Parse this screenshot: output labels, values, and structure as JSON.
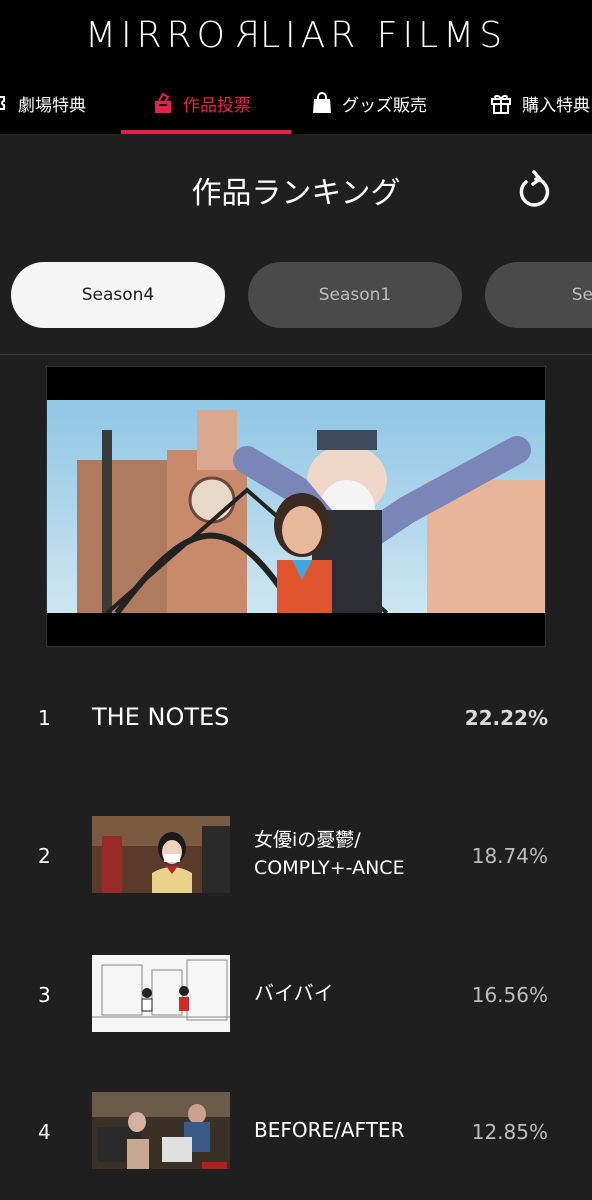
{
  "app": {
    "logo_prefix": "MIRRO",
    "logo_mirror": "R",
    "logo_suffix": "LIAR FILMS"
  },
  "nav": {
    "items": [
      {
        "label": "劇場特典",
        "icon": "ticket-icon"
      },
      {
        "label": "作品投票",
        "icon": "ballot-box-icon",
        "active": true
      },
      {
        "label": "グッズ販売",
        "icon": "shopping-bag-icon"
      },
      {
        "label": "購入特典",
        "icon": "gift-icon"
      }
    ]
  },
  "ranking": {
    "title": "作品ランキング",
    "refresh_icon": "refresh-icon"
  },
  "seasons": [
    "Season4",
    "Season1",
    "Seas"
  ],
  "active_season": "Season4",
  "rows": [
    {
      "rank": "1",
      "title": "THE NOTES",
      "percent": "22.22%"
    },
    {
      "rank": "2",
      "title_line1": "女優iの憂鬱/",
      "title_line2": "COMPLY+-ANCE",
      "percent": "18.74%"
    },
    {
      "rank": "3",
      "title": "バイバイ",
      "percent": "16.56%"
    },
    {
      "rank": "4",
      "title": "BEFORE/AFTER",
      "percent": "12.85%"
    }
  ],
  "colors": {
    "accent": "#e4224b",
    "background": "#1f1f1f",
    "header": "#000000"
  }
}
